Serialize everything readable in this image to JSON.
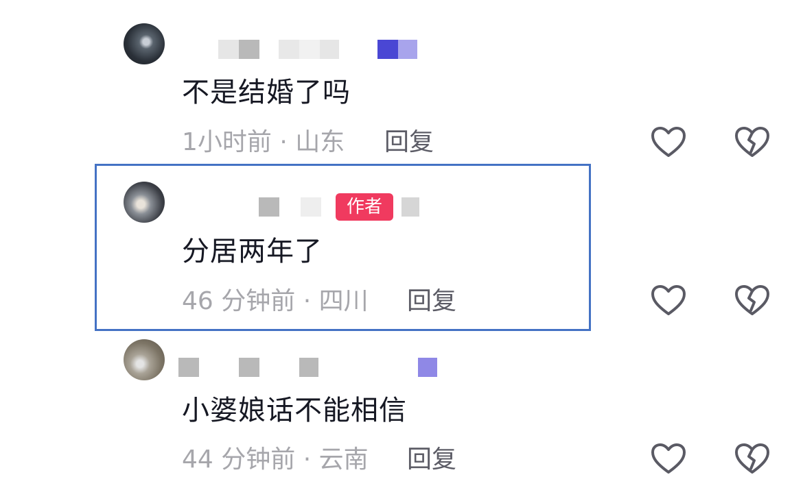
{
  "comments": [
    {
      "text": "不是结婚了吗",
      "time": "1小时前 · 山东",
      "reply_label": "回复",
      "like_icon": "heart-outline-icon",
      "dislike_icon": "broken-heart-icon"
    },
    {
      "text": "分居两年了",
      "badge": "作者",
      "time": "46 分钟前 · 四川",
      "reply_label": "回复",
      "like_icon": "heart-outline-icon",
      "dislike_icon": "broken-heart-icon"
    },
    {
      "text": "小婆娘话不能相信",
      "time": "44 分钟前 · 云南",
      "reply_label": "回复",
      "like_icon": "heart-outline-icon",
      "dislike_icon": "broken-heart-icon"
    }
  ],
  "colors": {
    "text": "#161823",
    "meta": "#a6a6ab",
    "reply": "#5c5c66",
    "author_badge": "#f03a5f",
    "highlight_border": "#4472c4",
    "icon_stroke": "#5a5a64"
  }
}
